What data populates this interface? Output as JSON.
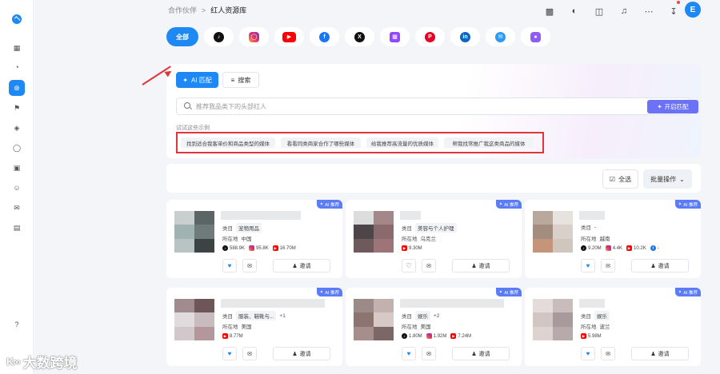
{
  "breadcrumb": {
    "parent": "合作伙伴",
    "sep": ">",
    "current": "红人资源库"
  },
  "avatar": {
    "initial": "E"
  },
  "tabs": {
    "all_label": "全部"
  },
  "panel": {
    "ai_mode_label": "AI 匹配",
    "search_mode_label": "搜索",
    "search_placeholder": "推荐我品类下的头部红人",
    "match_button_label": "开启匹配",
    "examples_label": "试试这些示例",
    "examples": [
      "找到适合我客单价和商品类型的媒体",
      "看看同类商家合作了哪些媒体",
      "给我推荐高流量的优质媒体",
      "帮我找常推广我这类商品的媒体"
    ]
  },
  "toolbar": {
    "select_all_label": "全选",
    "batch_label": "批量操作"
  },
  "card_labels": {
    "ai_badge": "AI 推荐",
    "category": "类目",
    "location": "所在地",
    "invite": "邀请"
  },
  "cards": [
    {
      "category": "宠物用品",
      "location": "中国",
      "tiktok": "588.9K",
      "instagram": "95.8K",
      "youtube": "16.70M"
    },
    {
      "category": "美容与个人护理",
      "location": "乌克兰",
      "youtube": "9.30M"
    },
    {
      "category": "-",
      "location": "越南",
      "tiktok": "9.20M",
      "instagram": "4.4K",
      "youtube": "10.2K",
      "facebook": "-"
    },
    {
      "category": "服装、鞋靴与...",
      "more": "+1",
      "location": "美国",
      "youtube": "8.77M"
    },
    {
      "category": "娱乐",
      "more": "+2",
      "location": "美国",
      "tiktok": "1.80M",
      "instagram": "1.92M",
      "youtube": "7.24M"
    },
    {
      "category": "娱乐",
      "location": "波兰",
      "youtube": "5.98M"
    }
  ],
  "watermark": {
    "text": "大数跨境",
    "logo": "K∞"
  },
  "colors": {
    "primary": "#1e88f5",
    "match": "#6b72f5",
    "highlight": "#e0353c",
    "ai_badge": "#5b7cf7"
  }
}
